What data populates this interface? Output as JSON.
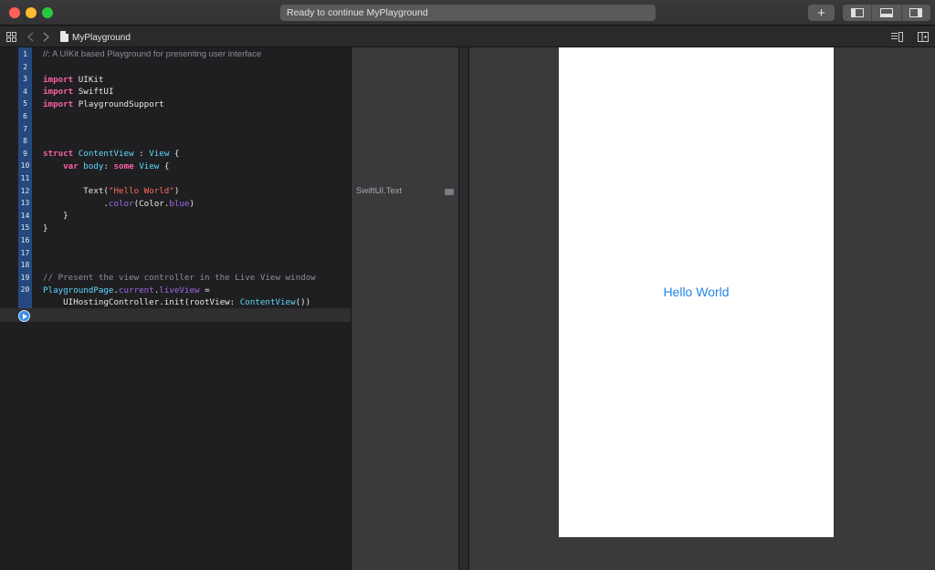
{
  "window": {
    "status_text": "Ready to continue MyPlayground"
  },
  "jumpbar": {
    "file_name": "MyPlayground"
  },
  "editor": {
    "line_numbers": [
      "1",
      "2",
      "3",
      "4",
      "5",
      "6",
      "7",
      "8",
      "9",
      "10",
      "11",
      "12",
      "13",
      "14",
      "15",
      "16",
      "17",
      "18",
      "19",
      "20"
    ],
    "comment_line_1": "//: A UIKit based Playground for presenting user interface",
    "import_kw": "import",
    "uikit": "UIKit",
    "swiftui": "SwiftUI",
    "playgroundsupport": "PlaygroundSupport",
    "struct_kw": "struct",
    "content_view": "ContentView",
    "colon": " : ",
    "view_type": "View",
    "brace_open": " {",
    "var_kw": "var",
    "body": "body",
    "some_kw": "some",
    "text_fn": "Text(",
    "hello_string": "\"Hello World\"",
    "paren_close": ")",
    "color_member": "color",
    "color_open": "(Color.",
    "blue": "blue",
    "brace_close": "}",
    "comment_present": "// Present the view controller in the Live View window",
    "playground_page": "PlaygroundPage",
    "current": "current",
    "live_view": "liveView",
    "assign": " =",
    "hosting_init": "UIHostingController.init(rootView: ",
    "content_view_call": "ContentView",
    "call_close": "())"
  },
  "results": {
    "result_1": "SwiftUI.Text"
  },
  "live_view": {
    "hello_text": "Hello World"
  },
  "colors": {
    "accent_blue": "#1e88e5",
    "keyword": "#fc5fa3",
    "type": "#5dd8ff",
    "string": "#fc6a5d"
  }
}
